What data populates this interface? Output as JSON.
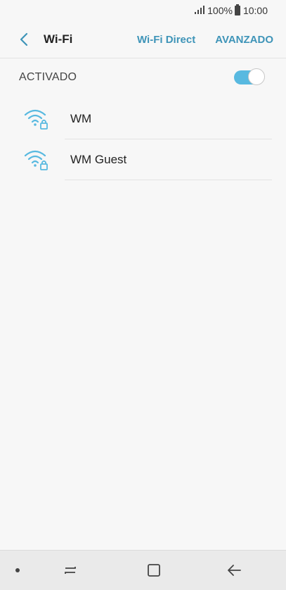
{
  "status_bar": {
    "battery": "100%",
    "time": "10:00"
  },
  "header": {
    "title": "Wi-Fi",
    "wifi_direct_label": "Wi-Fi Direct",
    "advanced_label": "AVANZADO"
  },
  "toggle": {
    "label": "ACTIVADO",
    "state": "on"
  },
  "networks": [
    {
      "name": "WM",
      "secured": true
    },
    {
      "name": "WM Guest",
      "secured": true
    }
  ],
  "colors": {
    "accent": "#3e94b8",
    "wifi_icon": "#58b9e0",
    "switch_on": "#58b9e0"
  }
}
